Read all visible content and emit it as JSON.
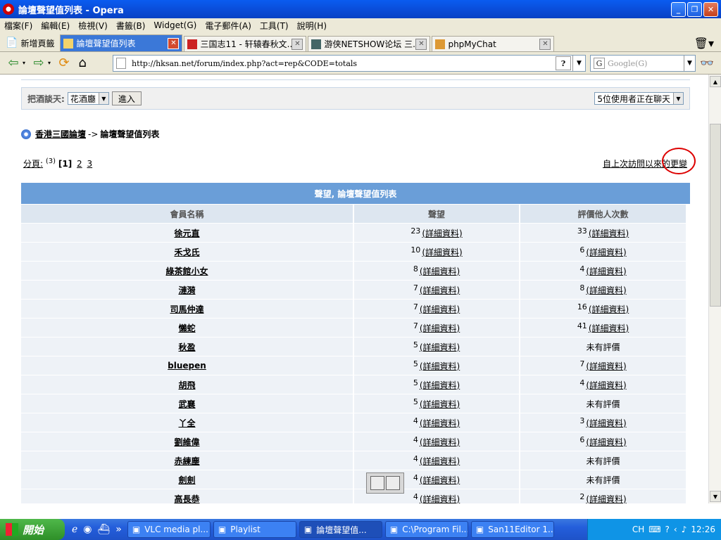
{
  "window": {
    "title": "論壇聲望值列表 - Opera"
  },
  "menu": [
    "檔案(F)",
    "編輯(E)",
    "檢視(V)",
    "書籤(B)",
    "Widget(G)",
    "電子郵件(A)",
    "工具(T)",
    "說明(H)"
  ],
  "tabs": {
    "new_tab_label": "新增頁籤",
    "items": [
      {
        "label": "論壇聲望值列表",
        "active": true
      },
      {
        "label": "三国志11 - 轩辕春秋文...",
        "active": false
      },
      {
        "label": "游侠NETSHOW论坛 三...",
        "active": false
      },
      {
        "label": "phpMyChat",
        "active": false
      }
    ]
  },
  "address": {
    "url": "http://hksan.net/forum/index.php?act=rep&CODE=totals",
    "help": "?"
  },
  "search": {
    "placeholder": "Google(G)",
    "engine_icon": "G"
  },
  "chat": {
    "label": "把酒談天:",
    "room": "花酒廳",
    "enter_button": "進入",
    "users_online": "5位使用者正在聊天"
  },
  "breadcrumb": {
    "home": "香港三國論壇",
    "sep": "->",
    "current": "論壇聲望值列表"
  },
  "pager": {
    "label": "分頁:",
    "count": "(3)",
    "current": "[1]",
    "pages": [
      "2",
      "3"
    ]
  },
  "since_last": "自上次訪問以來的更變",
  "table": {
    "caption": "聲望, 論壇聲望值列表",
    "headers": [
      "會員名稱",
      "聲望",
      "評價他人次數"
    ],
    "detail_label": "(詳細資料)",
    "no_rating": "未有評價",
    "rows": [
      {
        "name": "徐元直",
        "rep": "23",
        "rated": "33"
      },
      {
        "name": "禾戈氏",
        "rep": "10",
        "rated": "6"
      },
      {
        "name": "綠茶館小女",
        "rep": "8",
        "rated": "4"
      },
      {
        "name": "漣漪",
        "rep": "7",
        "rated": "8"
      },
      {
        "name": "司馬仲達",
        "rep": "7",
        "rated": "16"
      },
      {
        "name": "懶蛇",
        "rep": "7",
        "rated": "41"
      },
      {
        "name": "秋盈",
        "rep": "5",
        "rated": ""
      },
      {
        "name": "bluepen",
        "rep": "5",
        "rated": "7"
      },
      {
        "name": "胡飛",
        "rep": "5",
        "rated": "4"
      },
      {
        "name": "武襄",
        "rep": "5",
        "rated": ""
      },
      {
        "name": "丫全",
        "rep": "4",
        "rated": "3"
      },
      {
        "name": "劉維偉",
        "rep": "4",
        "rated": "6"
      },
      {
        "name": "赤練塵",
        "rep": "4",
        "rated": ""
      },
      {
        "name": "劍劍",
        "rep": "4",
        "rated": ""
      },
      {
        "name": "高長恭",
        "rep": "4",
        "rated": "2"
      }
    ]
  },
  "taskbar": {
    "start": "開始",
    "tasks": [
      {
        "label": "VLC media pl...",
        "active": false
      },
      {
        "label": "Playlist",
        "active": false
      },
      {
        "label": "論壇聲望值...",
        "active": true
      },
      {
        "label": "C:\\Program Fil...",
        "active": false
      },
      {
        "label": "San11Editor 1....",
        "active": false
      }
    ],
    "lang": "CH",
    "clock": "12:26"
  }
}
